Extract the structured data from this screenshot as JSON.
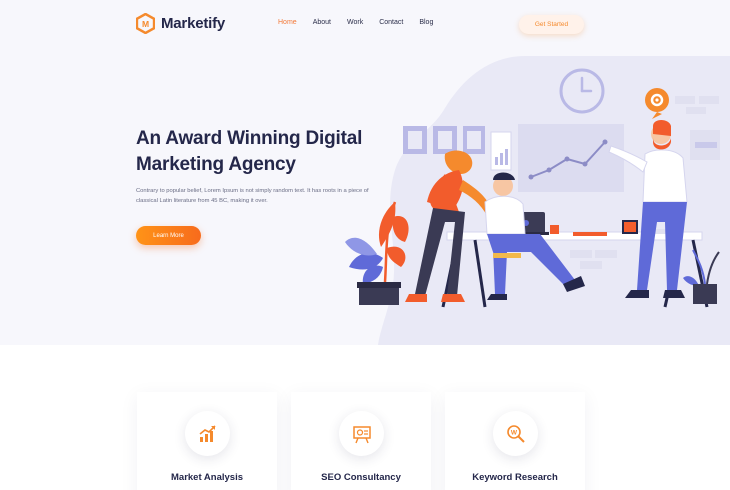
{
  "brand": {
    "name": "Marketify",
    "logo_letter": "M",
    "accent": "#f58a2d"
  },
  "nav": {
    "items": [
      {
        "label": "Home",
        "active": true
      },
      {
        "label": "About",
        "active": false
      },
      {
        "label": "Work",
        "active": false
      },
      {
        "label": "Contact",
        "active": false
      },
      {
        "label": "Blog",
        "active": false
      }
    ]
  },
  "header": {
    "cta_label": "Get Started"
  },
  "hero": {
    "title": "An Award Winning Digital Marketing Agency",
    "description": "Contrary to popular belief, Lorem Ipsum is not simply random text. It has roots in a piece of classical Latin literature from 45 BC, making it over.",
    "button_label": "Learn More"
  },
  "services": [
    {
      "title": "Market Analysis",
      "icon": "growth-chart-icon"
    },
    {
      "title": "SEO Consultancy",
      "icon": "seo-board-icon"
    },
    {
      "title": "Keyword Research",
      "icon": "keyword-search-icon"
    }
  ],
  "colors": {
    "orange": "#f58a2d",
    "navy": "#24274a",
    "lavender": "#e6e6f5",
    "purple": "#b9b9e6"
  }
}
